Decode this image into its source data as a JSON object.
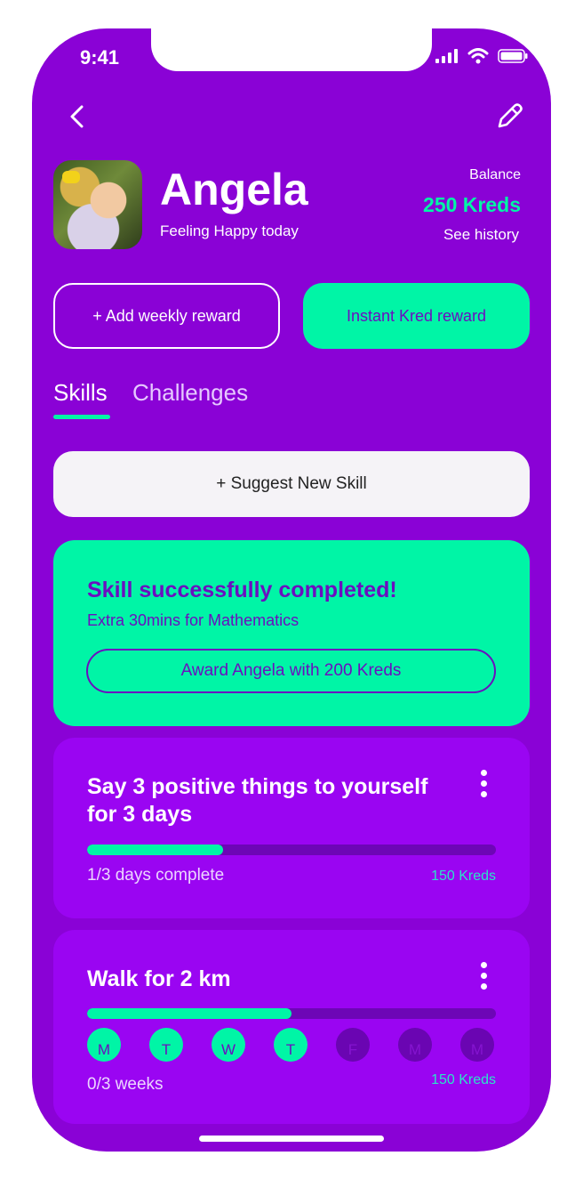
{
  "status_bar": {
    "time": "9:41"
  },
  "profile": {
    "name": "Angela",
    "mood": "Feeling Happy today",
    "balance_label": "Balance",
    "balance_value": "250 Kreds",
    "history_link": "See history"
  },
  "actions": {
    "add_weekly_reward": "+ Add weekly reward",
    "instant_kred_reward": "Instant Kred reward"
  },
  "tabs": [
    {
      "label": "Skills",
      "active": true
    },
    {
      "label": "Challenges",
      "active": false
    }
  ],
  "suggest_button": "+ Suggest New Skill",
  "success_card": {
    "title": "Skill successfully completed!",
    "subtitle": "Extra 30mins for Mathematics",
    "award_button": "Award Angela with 200 Kreds"
  },
  "tasks": [
    {
      "title": "Say 3 positive things to yourself for 3 days",
      "progress": 0.333,
      "progress_text": "1/3 days complete",
      "reward": "150 Kreds"
    },
    {
      "title": "Walk for 2 km",
      "progress": 0.5,
      "progress_text": "0/3 weeks",
      "reward": "150 Kreds",
      "days": [
        {
          "label": "M",
          "done": true
        },
        {
          "label": "T",
          "done": true
        },
        {
          "label": "W",
          "done": true
        },
        {
          "label": "T",
          "done": true
        },
        {
          "label": "F",
          "done": false
        },
        {
          "label": "M",
          "done": false
        },
        {
          "label": "M",
          "done": false
        }
      ]
    }
  ],
  "colors": {
    "background": "#8a02d6",
    "card": "#9a05f2",
    "accent": "#00f5a6",
    "text_purple": "#6b0fbf"
  },
  "icons": {
    "back": "chevron-left-icon",
    "edit": "pencil-icon",
    "more": "kebab-menu-icon",
    "signal": "cellular-signal-icon",
    "wifi": "wifi-icon",
    "battery": "battery-icon"
  }
}
